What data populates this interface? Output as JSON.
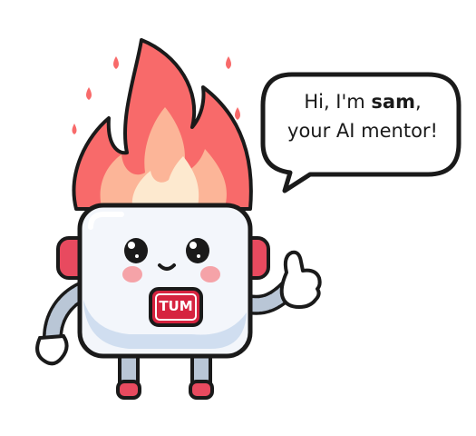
{
  "speech_bubble": {
    "greeting": "Hi, I'm ",
    "name": "sam",
    "comma": ",",
    "line2": "your AI mentor!"
  },
  "mascot": {
    "chest_logo_text": "TUM",
    "colors": {
      "flame_outer": "#f86a6a",
      "flame_inner": "#fcb598",
      "flame_core": "#fde9cf",
      "body": "#f3f6fb",
      "body_shade": "#c7d8ee",
      "cheeks": "#f5a3a8",
      "logo_badge": "#d6233f",
      "outline": "#1a1a1a",
      "limbs": "#b9c6d6",
      "feet": "#e84a5f"
    }
  }
}
